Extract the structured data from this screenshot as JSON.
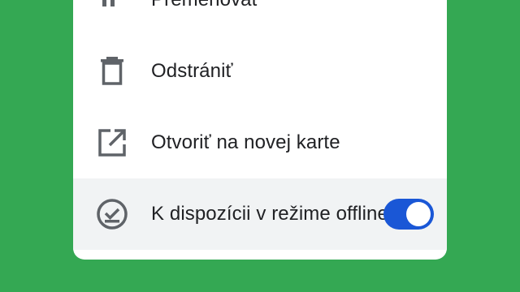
{
  "menu": {
    "items": [
      {
        "label": "Premenovať",
        "icon": "rename-icon"
      },
      {
        "label": "Odstrániť",
        "icon": "trash-icon"
      },
      {
        "label": "Otvoriť na novej karte",
        "icon": "open-in-new-icon"
      },
      {
        "label": "K dispozícii v režime offline",
        "icon": "offline-check-icon",
        "toggle_on": true
      }
    ]
  },
  "colors": {
    "background": "#34a853",
    "sheet": "#ffffff",
    "highlight_row": "#f1f3f4",
    "toggle_on": "#1a57d6",
    "icon": "#5f6368",
    "text": "#202124"
  }
}
